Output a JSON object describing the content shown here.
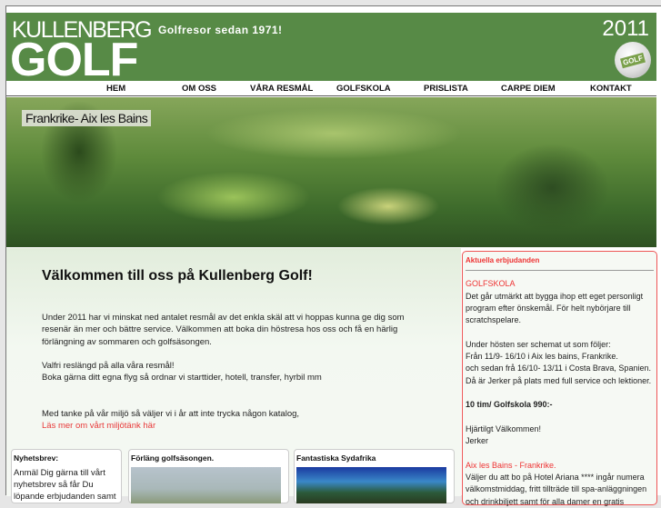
{
  "header": {
    "logo_top": "KULLENBERG",
    "logo_bottom": "GOLF",
    "tagline": "Golfresor sedan 1971!",
    "year": "2011",
    "ball_text": "GOLF"
  },
  "nav": [
    {
      "label": "HEM"
    },
    {
      "label": "OM OSS"
    },
    {
      "label": "VÅRA RESMÅL"
    },
    {
      "label": "GOLFSKOLA"
    },
    {
      "label": "PRISLISTA"
    },
    {
      "label": "CARPE DIEM"
    },
    {
      "label": "KONTAKT"
    }
  ],
  "hero": {
    "label": "Frankrike- Aix les Bains"
  },
  "main": {
    "title": "Välkommen till oss på Kullenberg Golf!",
    "p1": "Under 2011 har vi minskat ned antalet resmål av det enkla skäl att vi hoppas kunna ge dig som resenär än mer och bättre service. Välkommen att boka din höstresa hos oss och få en härlig förlängning av sommaren och golfsäsongen.",
    "p2a": "Valfri reslängd på alla våra resmål!",
    "p2b": "Boka gärna ditt egna flyg så ordnar vi starttider, hotell, transfer, hyrbil mm",
    "p3": "Med tanke på vår miljö så väljer vi i år att inte trycka någon katalog,",
    "link": "Läs mer om vårt miljötänk här"
  },
  "boxes": [
    {
      "title": "Nyhetsbrev:",
      "text": "Anmäl Dig gärna till vårt nyhetsbrev så får Du löpande erbjudanden samt"
    },
    {
      "title": "Förläng golfsäsongen."
    },
    {
      "title": "Fantastiska Sydafrika"
    }
  ],
  "side": {
    "title": "Aktuella erbjudanden",
    "h1": "GOLFSKOLA",
    "t1": "Det går utmärkt att bygga ihop ett eget personligt program efter önskemål. För helt nybörjare till scratchspelare.",
    "t2a": "Under hösten ser schemat ut som följer:",
    "t2b": "Från 11/9- 16/10 i Aix les bains, Frankrike.",
    "t2c": "och sedan frå 16/10- 13/11 i Costa Brava, Spanien.",
    "t2d": "Då är Jerker på plats med full service och lektioner.",
    "price": "10 tim/ Golfskola 990:-",
    "t3a": "Hjärtilgt Välkommen!",
    "t3b": "Jerker",
    "h2": "Aix les Bains - Frankrike.",
    "t4": "Väljer du att bo på Hotel Ariana **** ingår numera välkomstmiddag, fritt tillträde till spa-anläggningen och drinkbiljett samt för alla damer en gratis"
  }
}
